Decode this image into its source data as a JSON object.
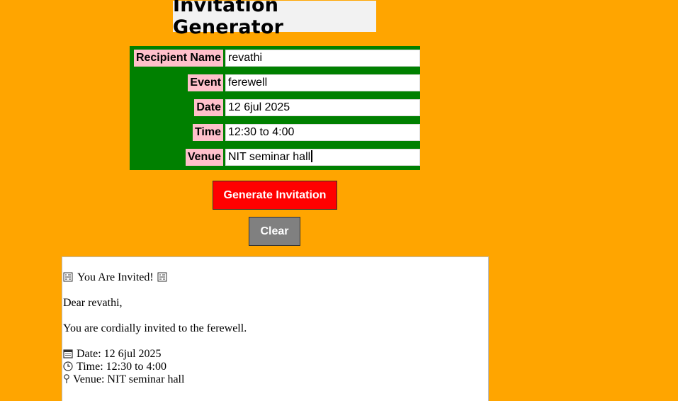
{
  "header": {
    "title": "Invitation Generator"
  },
  "form": {
    "fields": [
      {
        "label": "Recipient Name",
        "value": "revathi"
      },
      {
        "label": "Event",
        "value": "ferewell"
      },
      {
        "label": "Date",
        "value": "12 6jul 2025"
      },
      {
        "label": "Time",
        "value": "12:30 to 4:00"
      },
      {
        "label": "Venue",
        "value": "NIT seminar hall"
      }
    ]
  },
  "buttons": {
    "generate_label": "Generate Invitation",
    "clear_label": "Clear"
  },
  "output": {
    "heading": "You Are Invited!",
    "greeting": "Dear revathi,",
    "body": "You are cordially invited to the ferewell.",
    "date_line": "Date: 12 6jul 2025",
    "time_line": "Time: 12:30 to 4:00",
    "venue_line": "Venue: NIT seminar hall",
    "icons": {
      "heading_left": "party-icon",
      "heading_right": "party-icon",
      "date": "calendar-icon",
      "time": "clock-icon",
      "venue": "pin-icon"
    }
  },
  "colors": {
    "page_background": "#FFA500",
    "form_background": "#008000",
    "label_background": "#FFC0CB",
    "generate_button": "#FF0000",
    "clear_button": "#808080"
  }
}
